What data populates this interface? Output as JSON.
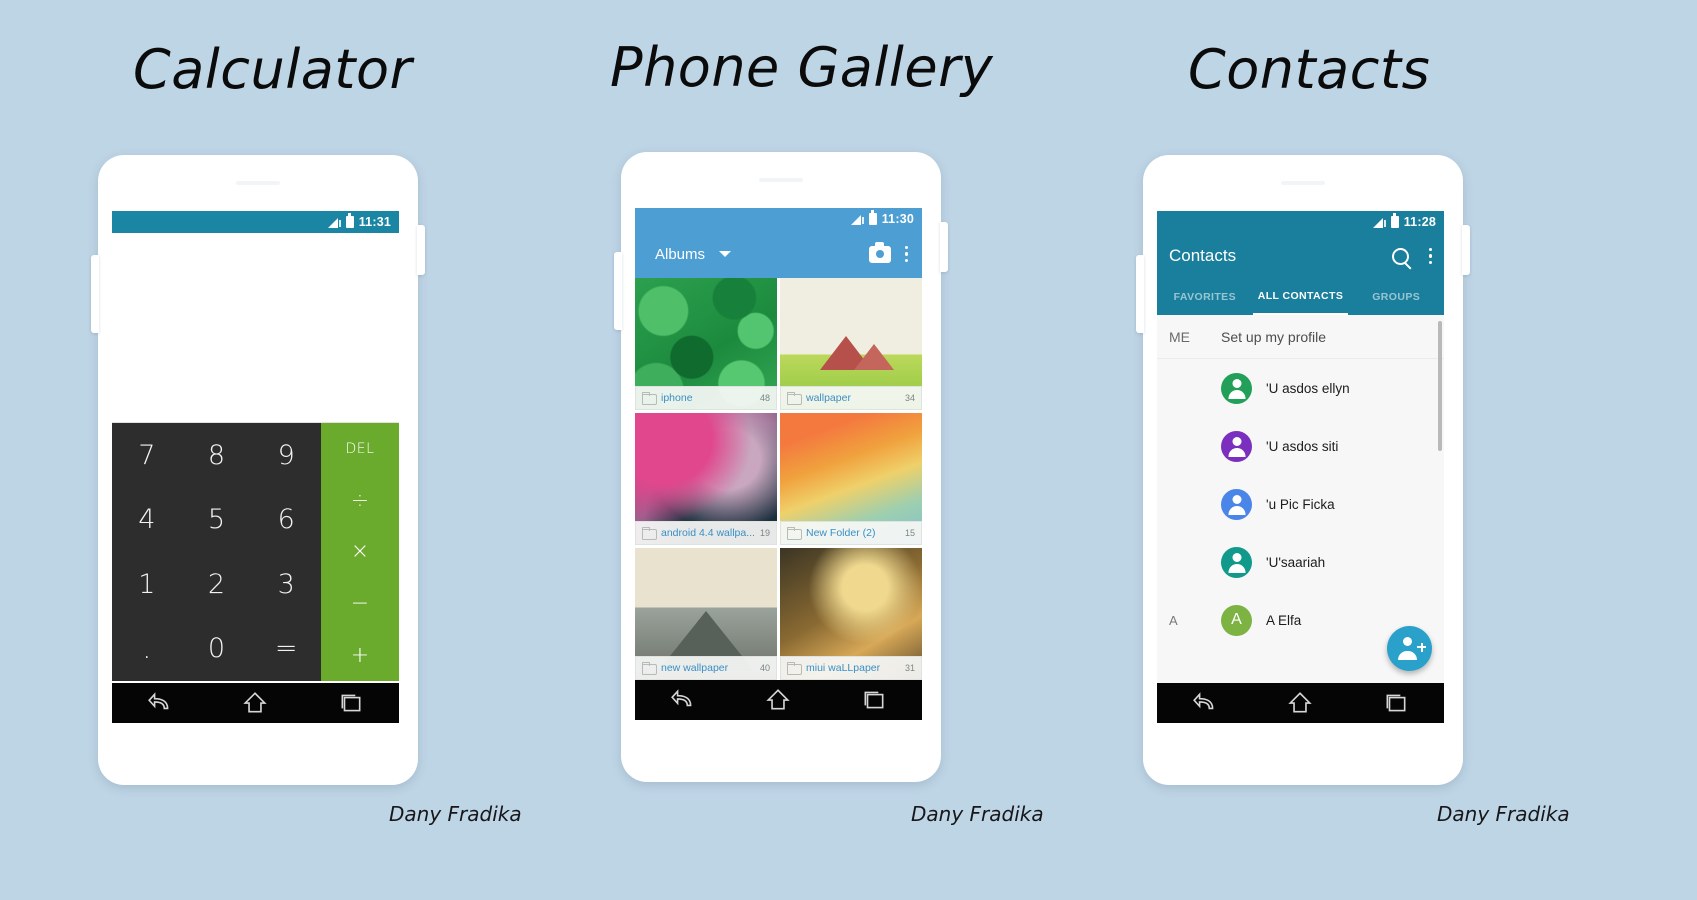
{
  "background_color": "#bed5e6",
  "signature": "Dany Fradika",
  "panels": {
    "calculator": {
      "title": "Calculator",
      "status": {
        "time": "11:31",
        "signal_icon": "signal-icon",
        "battery_icon": "battery-icon"
      },
      "statusbar_color": "#1b86a4",
      "display_value": "",
      "keys": [
        "7",
        "8",
        "9",
        "4",
        "5",
        "6",
        "1",
        "2",
        "3",
        ".",
        "0",
        "="
      ],
      "ops": [
        "DEL",
        "÷",
        "×",
        "−",
        "+"
      ],
      "ops_color": "#6aab2d",
      "keypad_color": "#2d2d2d"
    },
    "gallery": {
      "title": "Phone Gallery",
      "status": {
        "time": "11:30",
        "signal_icon": "signal-icon",
        "battery_icon": "battery-icon"
      },
      "appbar_color": "#4c9ed3",
      "appbar": {
        "title": "Albums",
        "dropdown_icon": "chevron-down-icon",
        "camera_icon": "camera-icon",
        "overflow_icon": "overflow-menu-icon"
      },
      "albums": [
        {
          "name": "iphone",
          "count": "48",
          "folder_icon": "folder-icon",
          "thumb": "tb-iphone"
        },
        {
          "name": "wallpaper",
          "count": "34",
          "folder_icon": "folder-icon",
          "thumb": "tb-wallpaper"
        },
        {
          "name": "android 4.4 wallpa...",
          "count": "19",
          "folder_icon": "folder-icon",
          "thumb": "tb-android"
        },
        {
          "name": "New Folder (2)",
          "count": "15",
          "folder_icon": "folder-icon",
          "thumb": "tb-newfolder"
        },
        {
          "name": "new wallpaper",
          "count": "40",
          "folder_icon": "folder-icon",
          "thumb": "tb-new"
        },
        {
          "name": "miui waLLpaper",
          "count": "31",
          "folder_icon": "folder-icon",
          "thumb": "tb-miui"
        }
      ]
    },
    "contacts": {
      "title": "Contacts",
      "status": {
        "time": "11:28",
        "signal_icon": "signal-icon",
        "battery_icon": "battery-icon"
      },
      "appbar_color": "#1a7f9c",
      "appbar": {
        "title": "Contacts",
        "search_icon": "search-icon",
        "overflow_icon": "overflow-menu-icon"
      },
      "tabs": [
        {
          "label": "FAVORITES",
          "active": false
        },
        {
          "label": "ALL CONTACTS",
          "active": true
        },
        {
          "label": "GROUPS",
          "active": false
        }
      ],
      "me_row": {
        "index": "ME",
        "text": "Set up my profile"
      },
      "rows": [
        {
          "index": "",
          "name": "'U asdos ellyn",
          "avatar_color": "#22a05a",
          "avatar_letter": ""
        },
        {
          "index": "",
          "name": "'U asdos siti",
          "avatar_color": "#7b2fbe",
          "avatar_letter": ""
        },
        {
          "index": "",
          "name": "'u Pic Ficka",
          "avatar_color": "#4a86e8",
          "avatar_letter": ""
        },
        {
          "index": "",
          "name": "'U'saariah",
          "avatar_color": "#119a8c",
          "avatar_letter": ""
        },
        {
          "index": "A",
          "name": "A Elfa",
          "avatar_color": "#7cb342",
          "avatar_letter": "A"
        }
      ],
      "fab": {
        "icon": "add-contact-icon",
        "color": "#29a1cb"
      }
    }
  },
  "navbar": {
    "back_icon": "back-icon",
    "home_icon": "home-icon",
    "recents_icon": "recents-icon"
  }
}
